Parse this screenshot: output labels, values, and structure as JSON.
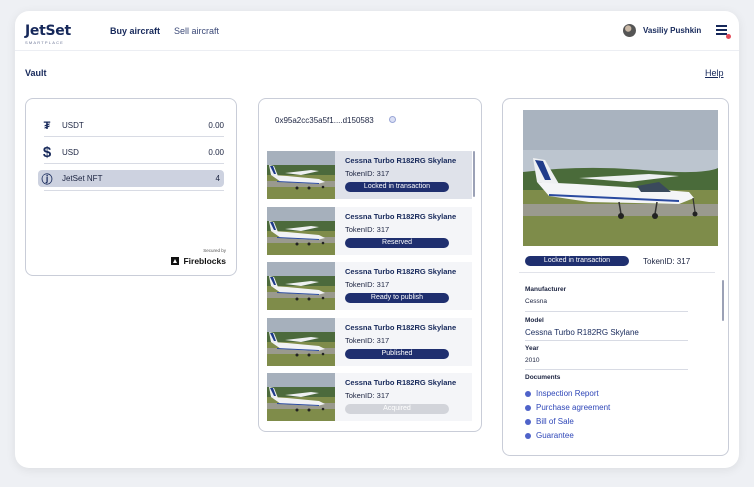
{
  "header": {
    "logo": "JetSet",
    "logo_sub": "SMARTPLACE",
    "nav": [
      "Buy aircraft",
      "Sell aircraft"
    ],
    "user_name": "Vasiliy Pushkin"
  },
  "page": {
    "title": "Vault",
    "help": "Help"
  },
  "balances": {
    "rows": [
      {
        "icon": "tether-icon",
        "glyph": "₮",
        "name": "USDT",
        "value": "0.00"
      },
      {
        "icon": "dollar-icon",
        "glyph": "$",
        "name": "USD",
        "value": "0.00"
      },
      {
        "icon": "jetset-nft-icon",
        "glyph": "ⓙ",
        "name": "JetSet NFT",
        "value": "4"
      }
    ],
    "secured_by": "Secured by",
    "provider": "Fireblocks"
  },
  "wallet": {
    "address": "0x95a2cc35a5f1....d150583"
  },
  "aircraft_list": [
    {
      "title": "Cessna Turbo R182RG Skylane",
      "token": "TokenID: 317",
      "status": "Locked in transaction",
      "status_color": "#1f2f6f"
    },
    {
      "title": "Cessna Turbo R182RG Skylane",
      "token": "TokenID: 317",
      "status": "Reserved",
      "status_color": "#1f2f6f"
    },
    {
      "title": "Cessna Turbo R182RG Skylane",
      "token": "TokenID: 317",
      "status": "Ready to publish",
      "status_color": "#1f2f6f"
    },
    {
      "title": "Cessna Turbo R182RG Skylane",
      "token": "TokenID: 317",
      "status": "Published",
      "status_color": "#1f2f6f"
    },
    {
      "title": "Cessna Turbo R182RG Skylane",
      "token": "TokenID: 317",
      "status": "Acquired",
      "status_color": "#d2d4da"
    }
  ],
  "detail": {
    "status": "Locked in transaction",
    "token": "TokenID: 317",
    "manufacturer_label": "Manufacturer",
    "manufacturer": "Cessna",
    "model_label": "Model",
    "model": "Cessna Turbo R182RG Skylane",
    "year_label": "Year",
    "year": "2010",
    "documents_label": "Documents",
    "documents": [
      "Inspection Report",
      "Purchase agreement",
      "Bill of Sale",
      "Guarantee"
    ]
  }
}
